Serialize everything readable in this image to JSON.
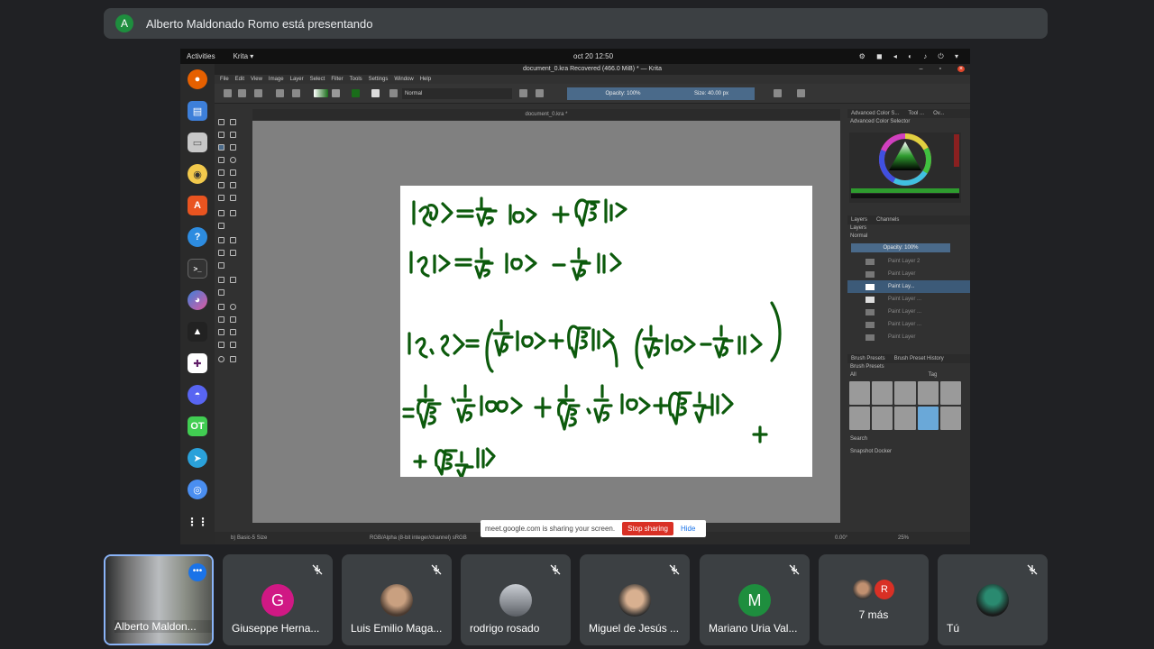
{
  "banner": {
    "avatar_letter": "A",
    "text": "Alberto Maldonado Romo está presentando"
  },
  "topbar": {
    "activities": "Activities",
    "app": "Krita ▾",
    "clock": "oct 20  12:50"
  },
  "krita": {
    "title": "document_0.kra Recovered  (466.0 MiB)  * — Krita",
    "menu": [
      "File",
      "Edit",
      "View",
      "Image",
      "Layer",
      "Select",
      "Filter",
      "Tools",
      "Settings",
      "Window",
      "Help"
    ],
    "blend_mode": "Normal",
    "opacity": "Opacity: 100%",
    "size": "Size: 40.00 px",
    "doc_tab": "document_0.kra *",
    "right_tabs": [
      "Advanced Color S...",
      "Tool ...",
      "Ov..."
    ],
    "color_selector_label": "Advanced Color Selector",
    "layers_tabs": [
      "Layers",
      "Channels"
    ],
    "layers_label": "Layers",
    "layers_blend": "Normal",
    "layers_opacity": "Opacity:  100%",
    "layers": [
      "Paint Layer 2",
      "Paint Layer",
      "Paint Lay...",
      "Paint Layer ...",
      "Paint Layer ...",
      "Paint Layer ...",
      "Paint Layer"
    ],
    "brush_tabs": [
      "Brush Presets",
      "Brush Preset History"
    ],
    "brush_presets_label": "Brush Presets",
    "brush_filter": "All",
    "brush_tag": "Tag",
    "brush_search": "Search",
    "snapshot": "Snapshot Docker",
    "status": {
      "brush": "b) Basic-5 Size",
      "colorspace": "RGB/Alpha (8-bit integer/channel)  sRGB",
      "dims": "2480 (466.0 MiB)",
      "angle": "0.00°",
      "zoom": "25%"
    }
  },
  "share_notice": {
    "text": "meet.google.com is sharing your screen.",
    "stop": "Stop sharing",
    "hide": "Hide"
  },
  "participants": [
    {
      "name": "Alberto Maldon..."
    },
    {
      "name": "Giuseppe Herna...",
      "letter": "G",
      "color": "#d01884"
    },
    {
      "name": "Luis Emilio Maga..."
    },
    {
      "name": "rodrigo rosado"
    },
    {
      "name": "Miguel de Jesús ..."
    },
    {
      "name": "Mariano Uria Val...",
      "letter": "M",
      "color": "#1e8e3e"
    },
    {
      "name": "7 más",
      "letter": "R",
      "color": "#d93025"
    },
    {
      "name": "Tú"
    }
  ],
  "colors": {
    "accent": "#1a73e8",
    "ink": "#0c5a0c",
    "stop": "#d93025"
  }
}
